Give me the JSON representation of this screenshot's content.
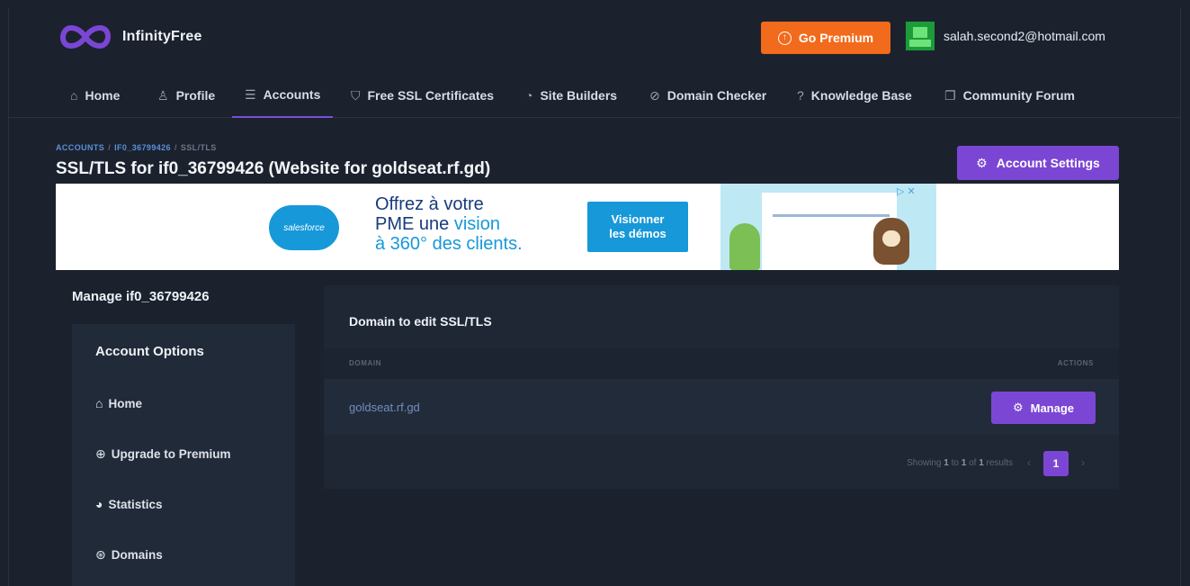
{
  "brand": {
    "name": "InfinityFree",
    "accent": "#7b46d4",
    "premium_color": "#f26a1b"
  },
  "header": {
    "go_premium_label": "Go Premium",
    "user_email": "salah.second2@hotmail.com"
  },
  "nav": {
    "items": [
      {
        "label": "Home",
        "icon": "home-icon"
      },
      {
        "label": "Profile",
        "icon": "user-icon"
      },
      {
        "label": "Accounts",
        "icon": "server-icon"
      },
      {
        "label": "Free SSL Certificates",
        "icon": "shield-icon"
      },
      {
        "label": "Site Builders",
        "icon": "palette-icon"
      },
      {
        "label": "Domain Checker",
        "icon": "check-circle-icon"
      },
      {
        "label": "Knowledge Base",
        "icon": "question-circle-icon"
      },
      {
        "label": "Community Forum",
        "icon": "chat-icon"
      }
    ],
    "active": "Accounts"
  },
  "breadcrumb": {
    "accounts": "ACCOUNTS",
    "account": "IF0_36799426",
    "current": "SSL/TLS"
  },
  "page": {
    "title": "SSL/TLS for if0_36799426 (Website for goldseat.rf.gd)",
    "account_settings_label": "Account Settings"
  },
  "ad": {
    "logo_text": "salesforce",
    "line1": "Offrez à votre",
    "line2a": "PME une ",
    "line2b": "vision",
    "line3": "à 360° des clients.",
    "button_line1": "Visionner",
    "button_line2": "les démos",
    "close_glyphs": "▷ ✕"
  },
  "sidebar": {
    "manage_title": "Manage if0_36799426",
    "heading": "Account Options",
    "items": [
      {
        "label": "Home",
        "icon": "home-icon"
      },
      {
        "label": "Upgrade to Premium",
        "icon": "arrow-up-circle-icon"
      },
      {
        "label": "Statistics",
        "icon": "chart-pie-icon"
      },
      {
        "label": "Domains",
        "icon": "globe-icon"
      }
    ]
  },
  "panel": {
    "title": "Domain to edit SSL/TLS",
    "col_domain": "DOMAIN",
    "col_actions": "ACTIONS",
    "rows": [
      {
        "domain": "goldseat.rf.gd",
        "action": "Manage"
      }
    ],
    "pagination": {
      "showing_prefix": "Showing ",
      "from": "1",
      "mid1": " to ",
      "to": "1",
      "mid2": " of ",
      "total": "1",
      "suffix": " results",
      "current_page": "1",
      "prev": "‹",
      "next": "›"
    }
  }
}
